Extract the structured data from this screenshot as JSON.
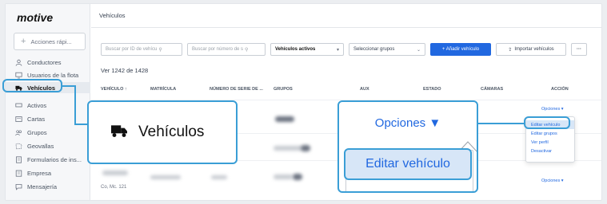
{
  "brand": {
    "logo_text": "motive"
  },
  "sidebar": {
    "new_action_label": "Acciones rápi...",
    "items": [
      {
        "label": "Conductores",
        "icon": "person-icon"
      },
      {
        "label": "Usuarios de la flota",
        "icon": "monitor-icon"
      },
      {
        "label": "Vehículos",
        "icon": "truck-icon",
        "active": true
      },
      {
        "label": "Activos",
        "icon": "trailer-icon"
      },
      {
        "label": "Cartas",
        "icon": "map-icon"
      },
      {
        "label": "Grupos",
        "icon": "group-icon"
      },
      {
        "label": "Geovallas",
        "icon": "geofence-icon"
      },
      {
        "label": "Formularios de ins...",
        "icon": "form-icon"
      },
      {
        "label": "Empresa",
        "icon": "building-icon"
      },
      {
        "label": "Mensajería",
        "icon": "message-icon"
      }
    ]
  },
  "header": {
    "title": "Vehículos"
  },
  "toolbar": {
    "search_id_placeholder": "Buscar por ID de vehícu",
    "search_serial_placeholder": "Buscar por número de s",
    "status_filter": "Vehículos activos",
    "group_filter": "Seleccionar grupos",
    "add_button": "+ Añadir vehículo",
    "import_button": "Importar vehículos",
    "more_button": "···"
  },
  "table": {
    "count_text": "Ver 1242 de 1428",
    "columns": [
      "VEHÍCULO ↑",
      "MATRÍCULA",
      "NÚMERO DE SERIE DE ...",
      "GRUPOS",
      "AUX",
      "ESTADO",
      "CÁMARAS",
      "ACCIÓN"
    ],
    "row_action_label": "Opciones ▾",
    "last_row_fragment": "Co, Mc. 121"
  },
  "action_menu": {
    "items": [
      "Editar vehículo",
      "Editar grupos",
      "Ver perfil",
      "Desactivar"
    ],
    "highlighted_index": 0
  },
  "callouts": {
    "nav_label": "Vehículos",
    "opciones_label": "Opciones ▼",
    "edit_label": "Editar vehículo"
  },
  "colors": {
    "accent": "#2168e0",
    "callout_border": "#3a9ed6",
    "highlight": "#d7e6f7"
  }
}
